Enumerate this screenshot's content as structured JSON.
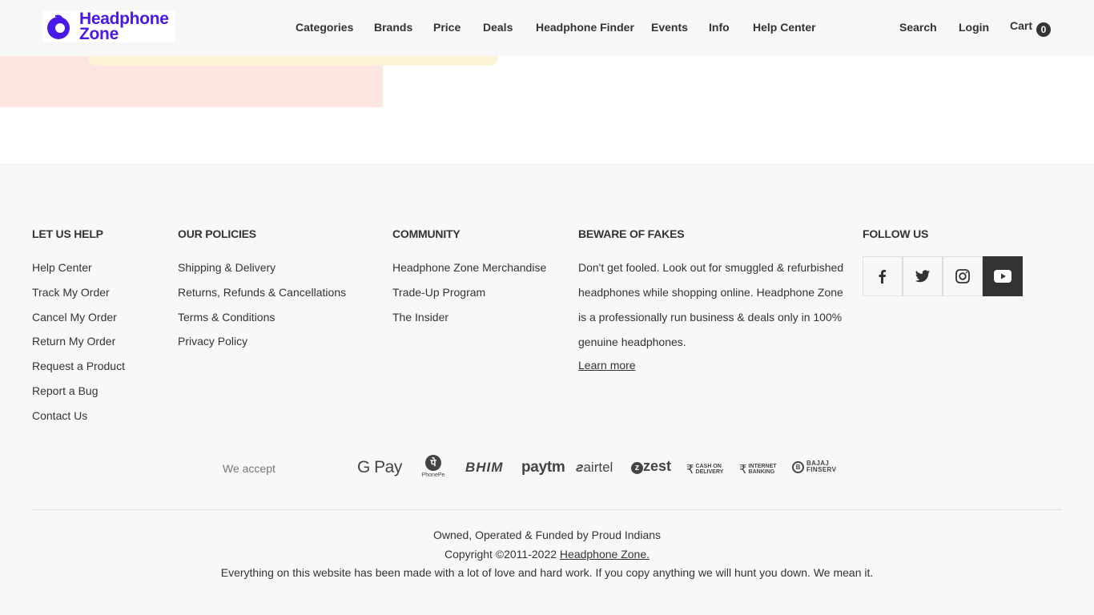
{
  "header": {
    "logo_line1": "Headphone",
    "logo_line2": "Zone",
    "nav": {
      "categories": "Categories",
      "brands": "Brands",
      "price": "Price",
      "deals": "Deals",
      "finder": "Headphone Finder",
      "events": "Events",
      "info": "Info",
      "help": "Help Center"
    },
    "search": "Search",
    "login": "Login",
    "cart": "Cart",
    "cart_count": "0"
  },
  "footer": {
    "let_us_help": {
      "title": "LET US HELP",
      "links": [
        "Help Center",
        "Track My Order",
        "Cancel My Order",
        "Return My Order",
        "Request a Product",
        "Report a Bug",
        "Contact Us"
      ]
    },
    "policies": {
      "title": "OUR POLICIES",
      "links": [
        "Shipping & Delivery",
        "Returns, Refunds & Cancellations",
        "Terms & Conditions",
        "Privacy Policy"
      ]
    },
    "community": {
      "title": "COMMUNITY",
      "links": [
        "Headphone Zone Merchandise",
        "Trade-Up Program",
        "The Insider"
      ]
    },
    "fakes": {
      "title": "BEWARE OF FAKES",
      "text": "Don't get fooled. Look out for smuggled & refurbished headphones while shopping online. Headphone Zone is a professionally run business & deals only in 100% genuine headphones.",
      "link": "Learn more"
    },
    "follow": {
      "title": "FOLLOW US",
      "icons": [
        "facebook-icon",
        "twitter-icon",
        "instagram-icon",
        "youtube-icon"
      ]
    },
    "payments": {
      "label": "We accept",
      "gpay": "G Pay",
      "phonepe": "PhonePe",
      "bhim": "BHIM",
      "paytm": "paytm",
      "airtel": "airtel",
      "zest": "zest",
      "cod_1": "CASH ON",
      "cod_2": "DELIVERY",
      "netbanking_1": "INTERNET",
      "netbanking_2": "BANKING",
      "bajaj_1": "BAJAJ",
      "bajaj_2": "FINSERV"
    },
    "bottom": {
      "line1": "Owned, Operated & Funded by Proud Indians",
      "copyright": "Copyright ©2011-2022",
      "company": "Headphone Zone.",
      "line3": "Everything on this website has been made with a lot of love and hard work. If you copy anything we will hunt you down. We mean it."
    }
  },
  "colors": {
    "brand": "#4a18e8",
    "header_bg": "#f7f7f7",
    "footer_bg": "#f8f8f8",
    "pink": "#fde5e2",
    "cream": "#fdf3d6"
  }
}
